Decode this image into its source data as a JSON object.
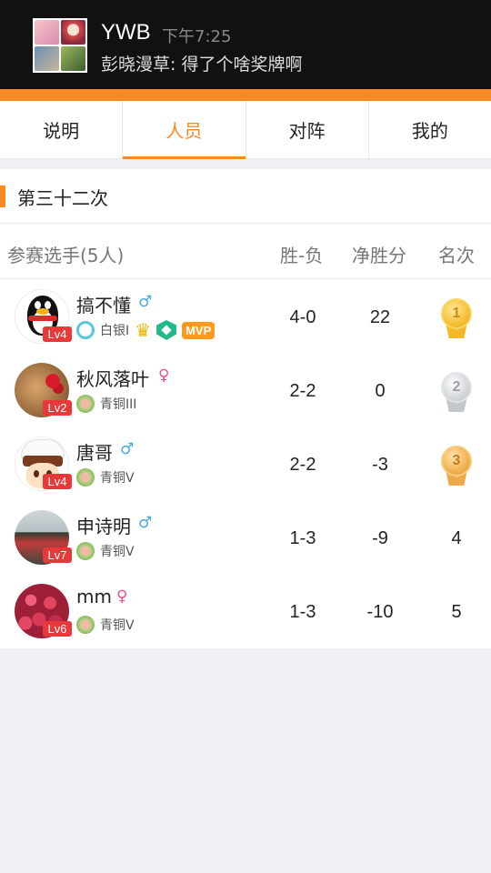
{
  "notification": {
    "title": "YWB",
    "time": "下午7:25",
    "message": "彭晓漫草: 得了个啥奖牌啊"
  },
  "tabs": [
    {
      "label": "说明",
      "active": false
    },
    {
      "label": "人员",
      "active": true
    },
    {
      "label": "对阵",
      "active": false
    },
    {
      "label": "我的",
      "active": false
    }
  ],
  "section": {
    "title": "第三十二次"
  },
  "table": {
    "headers": {
      "name": "参赛选手(5人)",
      "wl": "胜-负",
      "net": "净胜分",
      "rank": "名次"
    },
    "rows": [
      {
        "name": "搞不懂",
        "gender": "♂",
        "level": "Lv4",
        "tier": "白银I",
        "wl": "4-0",
        "net": "22",
        "rank": "1",
        "medal": "gold",
        "badges": [
          "crown-icon",
          "shield-icon",
          "MVP"
        ]
      },
      {
        "name": "秋风落叶",
        "gender": "♀",
        "level": "Lv2",
        "tier": "青铜III",
        "wl": "2-2",
        "net": "0",
        "rank": "2",
        "medal": "silver"
      },
      {
        "name": "唐哥",
        "gender": "♂",
        "level": "Lv4",
        "tier": "青铜V",
        "wl": "2-2",
        "net": "-3",
        "rank": "3",
        "medal": "bronze"
      },
      {
        "name": "申诗明",
        "gender": "♂",
        "level": "Lv7",
        "tier": "青铜V",
        "wl": "1-3",
        "net": "-9",
        "rank": "4"
      },
      {
        "name": "mm",
        "gender": "♀",
        "level": "Lv6",
        "tier": "青铜V",
        "wl": "1-3",
        "net": "-10",
        "rank": "5"
      }
    ]
  },
  "colors": {
    "accent": "#fb8a22",
    "level_badge": "#e8393a",
    "male": "#4aa8e0",
    "female": "#ef4f8b"
  }
}
